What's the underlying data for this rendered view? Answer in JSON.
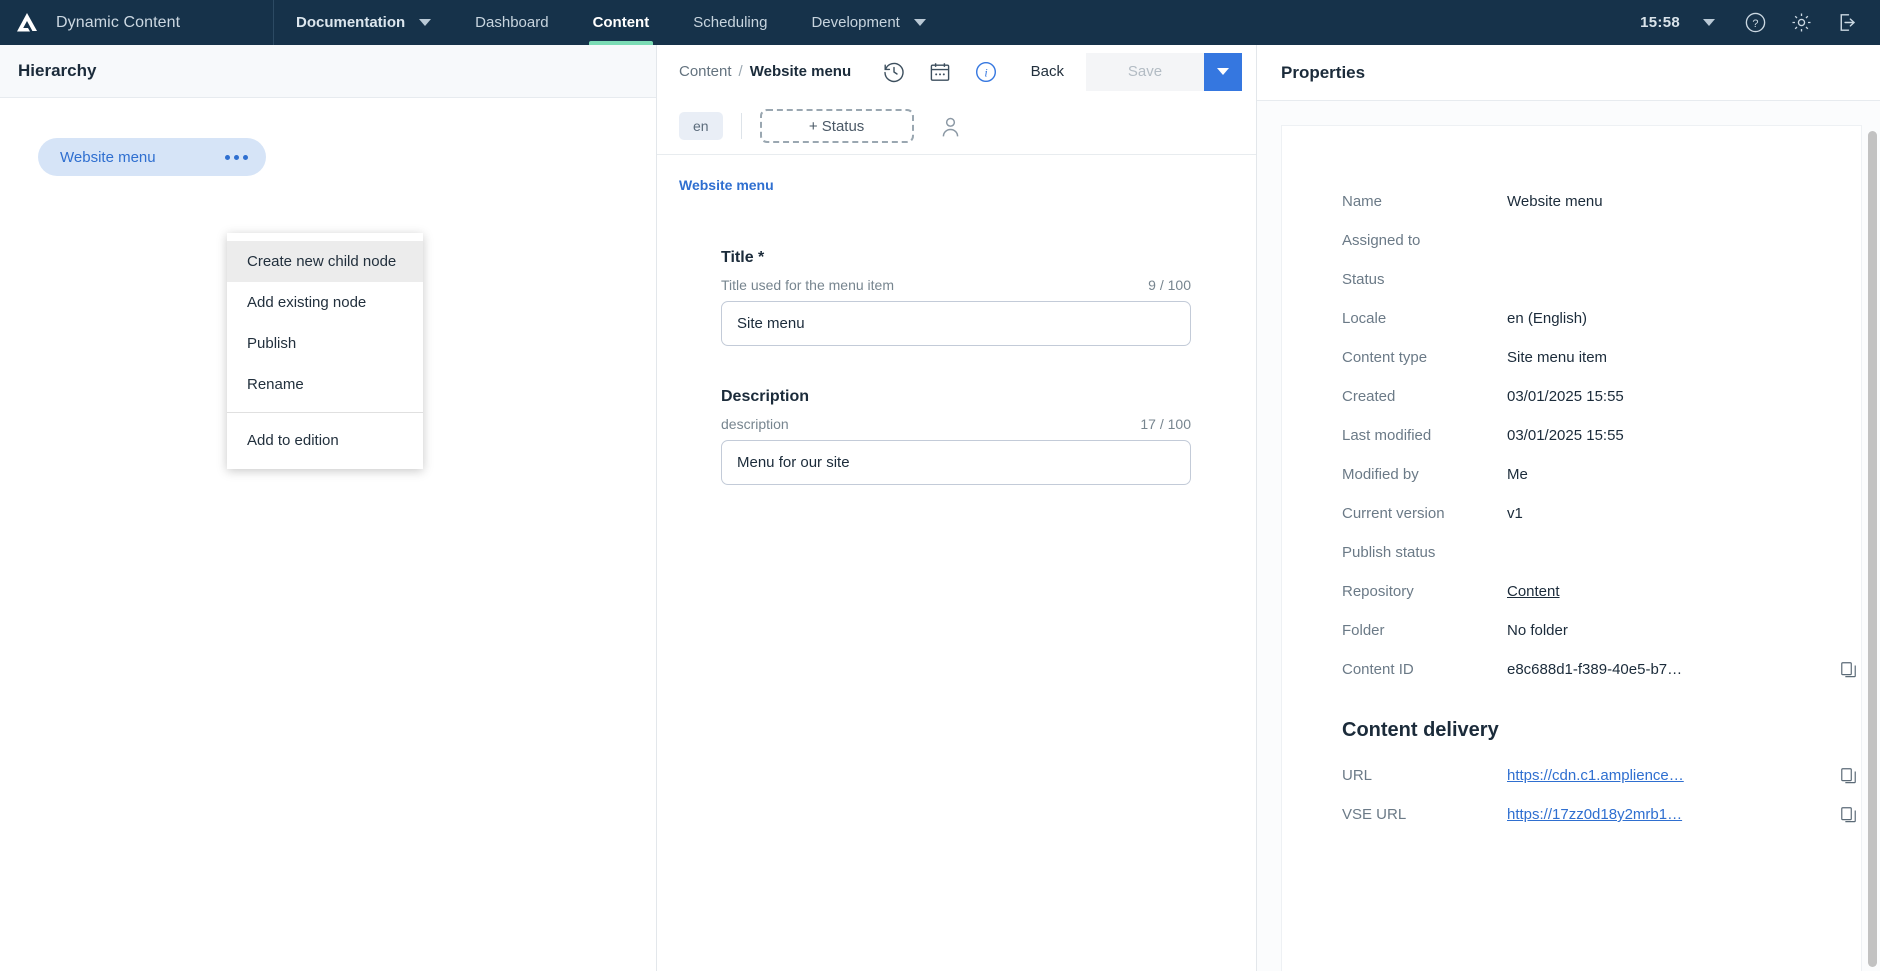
{
  "topnav": {
    "brand": "Dynamic Content",
    "logo_icon": "amplience-logo-icon",
    "items": [
      {
        "label": "Documentation",
        "icon": "chevron-down-icon",
        "bold": true,
        "active": false
      },
      {
        "label": "Dashboard",
        "icon": "",
        "bold": false,
        "active": false
      },
      {
        "label": "Content",
        "icon": "",
        "bold": false,
        "active": true
      },
      {
        "label": "Scheduling",
        "icon": "",
        "bold": false,
        "active": false
      },
      {
        "label": "Development",
        "icon": "chevron-down-icon",
        "bold": false,
        "active": false
      }
    ],
    "clock": "15:58",
    "clock_caret_icon": "chevron-down-icon",
    "help_icon": "help-circle-icon",
    "settings_icon": "gear-icon",
    "logout_icon": "logout-icon",
    "accent_active": "#7bdcb5",
    "background": "#16324a"
  },
  "hierarchy": {
    "title": "Hierarchy",
    "node": {
      "label": "Website menu",
      "menu_icon": "ellipsis-icon",
      "pill_bg": "#d6e4f7",
      "text_color": "#2f6fd0"
    },
    "context_menu": {
      "items": [
        {
          "label": "Create new child node",
          "highlighted": true
        },
        {
          "label": "Add existing node",
          "highlighted": false
        },
        {
          "label": "Publish",
          "highlighted": false
        },
        {
          "label": "Rename",
          "highlighted": false
        }
      ],
      "items_after_divider": [
        {
          "label": "Add to edition",
          "highlighted": false
        }
      ]
    }
  },
  "content_header": {
    "breadcrumb_root": "Content",
    "breadcrumb_sep": "/",
    "breadcrumb_current": "Website menu",
    "history_icon": "history-clock-icon",
    "calendar_icon": "calendar-icon",
    "info_icon": "info-circle-icon",
    "back_label": "Back",
    "save_label": "Save",
    "save_caret_icon": "chevron-down-icon",
    "save_accent": "#3577e0",
    "locale_chip": "en",
    "status_button": "+ Status",
    "assignee_icon": "person-icon"
  },
  "form": {
    "tab_label": "Website menu",
    "fields": [
      {
        "label": "Title *",
        "hint": "Title used for the menu item",
        "counter": "9 / 100",
        "value": "Site menu",
        "placeholder": ""
      },
      {
        "label": "Description",
        "hint": "description",
        "counter": "17 / 100",
        "value": "Menu for our site",
        "placeholder": ""
      }
    ]
  },
  "properties": {
    "title": "Properties",
    "rows": [
      {
        "key": "Name",
        "value": "Website menu",
        "style": "plain",
        "copy": false
      },
      {
        "key": "Assigned to",
        "value": "",
        "style": "plain",
        "copy": false
      },
      {
        "key": "Status",
        "value": "",
        "style": "plain",
        "copy": false
      },
      {
        "key": "Locale",
        "value": "en (English)",
        "style": "plain",
        "copy": false
      },
      {
        "key": "Content type",
        "value": "Site menu item",
        "style": "plain",
        "copy": false
      },
      {
        "key": "Created",
        "value": "03/01/2025 15:55",
        "style": "plain",
        "copy": false
      },
      {
        "key": "Last modified",
        "value": "03/01/2025 15:55",
        "style": "plain",
        "copy": false
      },
      {
        "key": "Modified by",
        "value": "Me",
        "style": "plain",
        "copy": false
      },
      {
        "key": "Current version",
        "value": "v1",
        "style": "plain",
        "copy": false
      },
      {
        "key": "Publish status",
        "value": "",
        "style": "plain",
        "copy": false
      },
      {
        "key": "Repository",
        "value": "Content",
        "style": "link",
        "copy": false
      },
      {
        "key": "Folder",
        "value": "No folder",
        "style": "plain",
        "copy": false
      },
      {
        "key": "Content ID",
        "value": "e8c688d1-f389-40e5-b7…",
        "style": "plain",
        "copy": true
      }
    ],
    "delivery_title": "Content delivery",
    "delivery_rows": [
      {
        "key": "URL",
        "value": "https://cdn.c1.amplience…",
        "style": "bluelink",
        "copy": true
      },
      {
        "key": "VSE URL",
        "value": "https://17zz0d18y2mrb1…",
        "style": "bluelink",
        "copy": true
      }
    ],
    "copy_icon": "copy-icon",
    "scrollbar": "vertical-scrollbar"
  }
}
